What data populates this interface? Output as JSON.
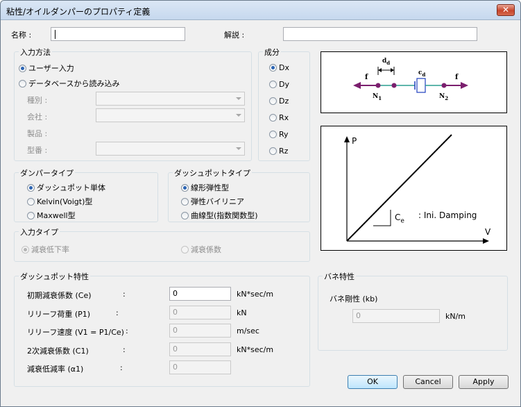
{
  "window": {
    "title": "粘性/オイルダンパーのプロパティ定義",
    "close": "✕"
  },
  "name": {
    "label": "名称 :",
    "value": ""
  },
  "description": {
    "label": "解説 :",
    "value": ""
  },
  "input_method": {
    "title": "入力方法",
    "options": [
      "ユーザー入力",
      "データベースから読み込み"
    ],
    "selected": 0,
    "fields": [
      {
        "label": "種別 :"
      },
      {
        "label": "会社 :"
      },
      {
        "label": "製品 :"
      },
      {
        "label": "型番 :"
      }
    ]
  },
  "component": {
    "title": "成分",
    "options": [
      "Dx",
      "Dy",
      "Dz",
      "Rx",
      "Ry",
      "Rz"
    ],
    "selected": 0
  },
  "damper_type": {
    "title": "ダンパータイプ",
    "options": [
      "ダッシュポット単体",
      "Kelvin(Voigt)型",
      "Maxwell型"
    ],
    "selected": 0
  },
  "dashpot_type": {
    "title": "ダッシュポットタイプ",
    "options": [
      "線形弾性型",
      "弾性バイリニア",
      "曲線型(指数関数型)"
    ],
    "selected": 0
  },
  "input_type": {
    "title": "入力タイプ",
    "options": [
      "減衰低下率",
      "減衰係数"
    ],
    "selected": 0
  },
  "dashpot_props": {
    "title": "ダッシュポット特性",
    "rows": [
      {
        "label": "初期減衰係数 (Ce)",
        "colon": ":",
        "value": "0",
        "unit": "kN*sec/m"
      },
      {
        "label": "リリーフ荷重 (P1)",
        "colon": ":",
        "value": "0",
        "unit": "kN"
      },
      {
        "label": "リリーフ速度 (V1 = P1/Ce)",
        "colon": ":",
        "value": "0",
        "unit": "m/sec"
      },
      {
        "label": "2次減衰係数 (C1)",
        "colon": ":",
        "value": "0",
        "unit": "kN*sec/m"
      },
      {
        "label": "減衰低減率 (α1)",
        "colon": ":",
        "value": "0",
        "unit": ""
      }
    ]
  },
  "spring_props": {
    "title": "バネ特性",
    "label": "バネ剛性 (kb)",
    "value": "0",
    "unit": "kN/m"
  },
  "diagram1": {
    "f_left": "f",
    "f_right": "f",
    "d": "d",
    "d_sub": "d",
    "c": "c",
    "c_sub": "d",
    "n1": "N",
    "n1_sub": "1",
    "n2": "N",
    "n2_sub": "2"
  },
  "diagram2": {
    "p_axis": "P",
    "v_axis": "V",
    "slope": "C",
    "slope_sub": "e",
    "caption": ": Ini.  Damping"
  },
  "buttons": {
    "ok": "OK",
    "cancel": "Cancel",
    "apply": "Apply"
  },
  "colors": {
    "arrow": "#7b1f6e",
    "node": "#7b1f6e",
    "link": "#2a9d8f",
    "damper": "#1f3fbf"
  }
}
